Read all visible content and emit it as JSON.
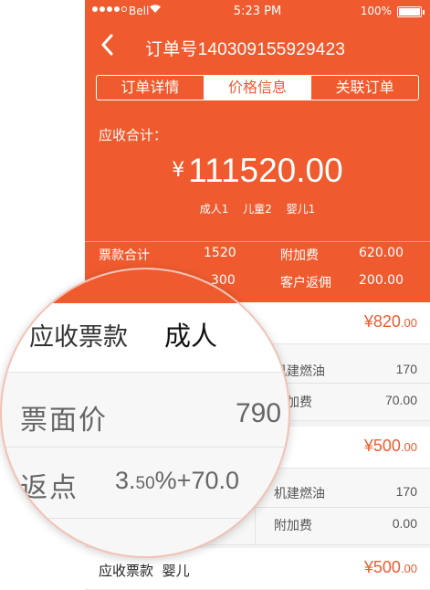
{
  "status": {
    "carrier": "Bell",
    "time": "5:23 PM",
    "battery": "100%"
  },
  "header": {
    "order_title": "订单号140309155929423",
    "tabs": [
      "订单详情",
      "价格信息",
      "关联订单"
    ],
    "total_label": "应收合计：",
    "currency": "¥",
    "total_amount": "111520.00",
    "pax": [
      "成人1",
      "儿童2",
      "婴儿1"
    ]
  },
  "summary": {
    "ticket_total_label": "票款合计",
    "ticket_total_value": "1520",
    "surcharge_label": "附加费",
    "surcharge_value": "620.00",
    "row2_value": "300",
    "rebate_label": "客户返佣",
    "rebate_value": "200.00"
  },
  "sections": [
    {
      "amount_main": "¥820",
      "amount_dec": ".00",
      "fuel_label": "机建燃油",
      "fuel_value": "170",
      "surcharge_label": "附加费",
      "surcharge_value": "70.00"
    },
    {
      "amount_main": "¥500",
      "amount_dec": ".00",
      "fuel_label": "机建燃油",
      "fuel_value": "170",
      "surcharge_label": "附加费",
      "surcharge_value": "0.00"
    },
    {
      "label": "应收票款",
      "category": "婴儿",
      "amount_main": "¥500",
      "amount_dec": ".00"
    }
  ],
  "magnifier": {
    "label": "应收票款",
    "category": "成人",
    "face_price_label": "票面价",
    "face_price_value": "790",
    "rebate_label": "返点",
    "rebate_main": "3.",
    "rebate_small": "50",
    "rebate_rest": "%+70.0"
  },
  "colors": {
    "accent": "#ef5b2f"
  }
}
